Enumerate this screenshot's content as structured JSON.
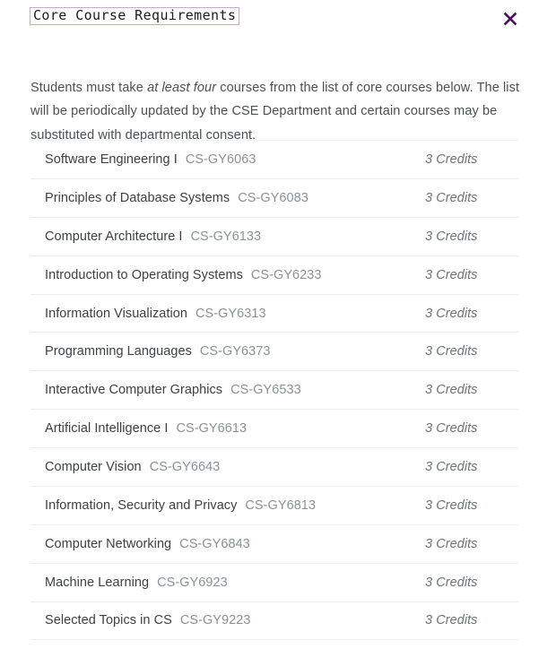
{
  "header": {
    "title": "Core Course Requirements",
    "close_icon": "close-icon",
    "title_border_color": "#c6a9d6",
    "close_icon_color": "#4b0d63"
  },
  "intro": {
    "part1": "Students must take ",
    "emphasis": "at least four",
    "part2": " courses from the list of core courses below. The list will be periodically updated by the CSE Department and certain courses may be substituted with departmental consent."
  },
  "courses": [
    {
      "name": "Software Engineering I",
      "code": "CS-GY6063",
      "credits": "3 Credits"
    },
    {
      "name": "Principles of Database Systems",
      "code": "CS-GY6083",
      "credits": "3 Credits"
    },
    {
      "name": "Computer Architecture I",
      "code": "CS-GY6133",
      "credits": "3 Credits"
    },
    {
      "name": "Introduction to Operating Systems",
      "code": "CS-GY6233",
      "credits": "3 Credits"
    },
    {
      "name": "Information Visualization",
      "code": "CS-GY6313",
      "credits": "3 Credits"
    },
    {
      "name": "Programming Languages",
      "code": "CS-GY6373",
      "credits": "3 Credits"
    },
    {
      "name": "Interactive Computer Graphics",
      "code": "CS-GY6533",
      "credits": "3 Credits"
    },
    {
      "name": "Artificial Intelligence I",
      "code": "CS-GY6613",
      "credits": "3 Credits"
    },
    {
      "name": "Computer Vision",
      "code": "CS-GY6643",
      "credits": "3 Credits"
    },
    {
      "name": "Information, Security and Privacy",
      "code": "CS-GY6813",
      "credits": "3 Credits"
    },
    {
      "name": "Computer Networking",
      "code": "CS-GY6843",
      "credits": "3 Credits"
    },
    {
      "name": "Machine Learning",
      "code": "CS-GY6923",
      "credits": "3 Credits"
    },
    {
      "name": "Selected Topics in CS",
      "code": "CS-GY9223",
      "credits": "3 Credits"
    }
  ]
}
